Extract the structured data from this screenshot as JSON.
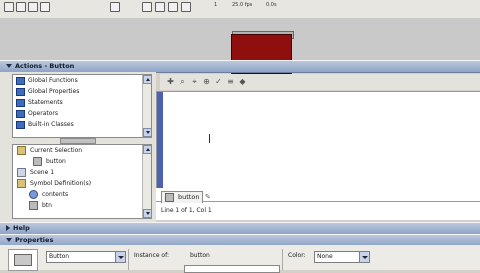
{
  "timeline": {
    "frame_number": "1",
    "fps": "25.0 fps",
    "elapsed": "0.0s"
  },
  "actions_panel": {
    "title": "Actions - Button",
    "toolbox_items": [
      {
        "label": "Global Functions"
      },
      {
        "label": "Global Properties"
      },
      {
        "label": "Statements"
      },
      {
        "label": "Operators"
      },
      {
        "label": "Built-in Classes"
      }
    ],
    "tree_items": [
      {
        "label": "Current Selection",
        "icon": "folder-icon"
      },
      {
        "label": "button",
        "icon": "button-icon"
      },
      {
        "label": "Scene 1",
        "icon": "scene-icon"
      },
      {
        "label": "Symbol Definition(s)",
        "icon": "folder-icon"
      },
      {
        "label": "contents",
        "icon": "movie-icon"
      },
      {
        "label": "btn",
        "icon": "button-icon"
      }
    ],
    "script_tab": "button",
    "status": "Line 1 of 1, Col 1"
  },
  "help_panel": {
    "title": "Help"
  },
  "properties_panel": {
    "title": "Properties",
    "symbol_type": "Button",
    "instance_label": "Instance of:",
    "instance_name": "button",
    "color_label": "Color:",
    "color_value": "None"
  }
}
